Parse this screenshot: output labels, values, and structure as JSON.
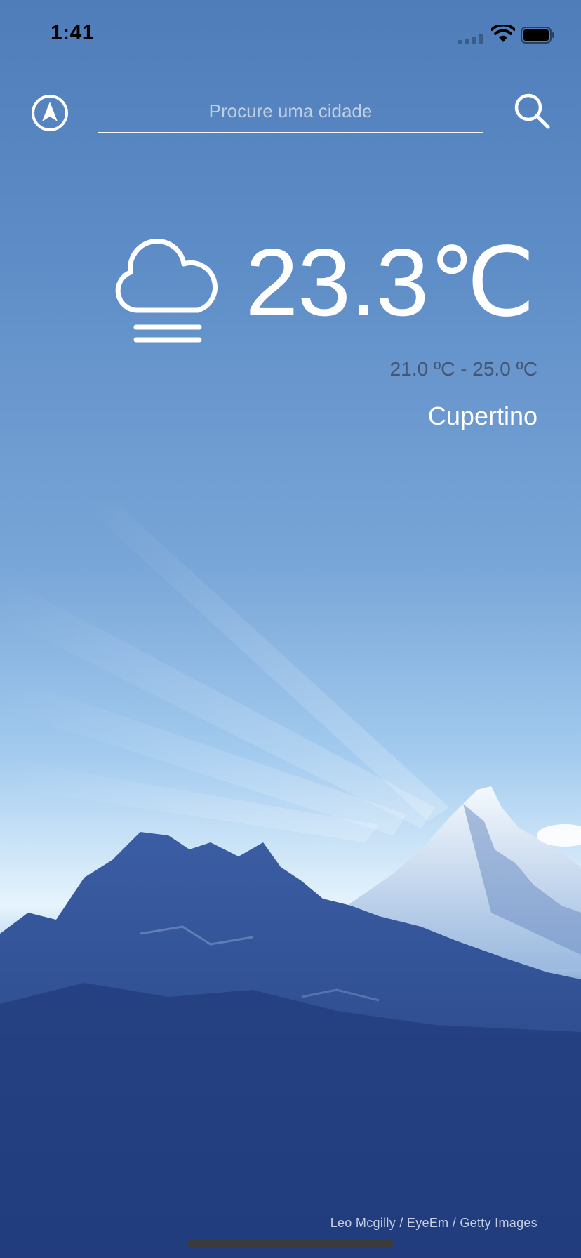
{
  "status_bar": {
    "time": "1:41"
  },
  "search": {
    "placeholder": "Procure uma cidade",
    "value": ""
  },
  "icons": {
    "location": "navigation-arrow-icon",
    "search": "magnifier-icon",
    "weather": "fog-cloud-icon"
  },
  "weather": {
    "temperature": "23.3℃",
    "range": "21.0 ºC - 25.0 ºC",
    "city": "Cupertino"
  },
  "photo": {
    "credit": "Leo Mcgilly / EyeEm / Getty Images"
  },
  "colors": {
    "sky_top": "#4f7dba",
    "sky_horizon": "#e6f4fd",
    "mountain": "#2a4a8b",
    "snow": "#e9f3fb",
    "text": "#ffffff"
  }
}
